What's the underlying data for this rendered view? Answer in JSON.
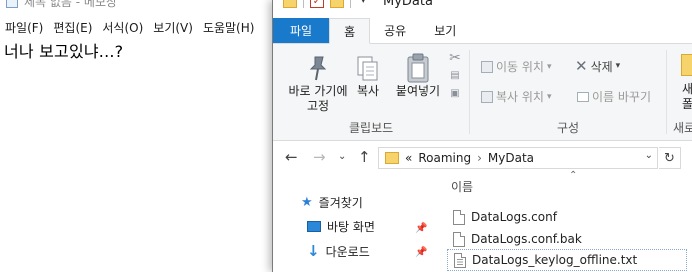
{
  "notepad": {
    "title": "제목 없음 - 메모장",
    "menu": [
      "파일(F)",
      "편집(E)",
      "서식(O)",
      "보기(V)",
      "도움말(H)"
    ],
    "content": "너나 보고있냐...?"
  },
  "explorer": {
    "title": "MyData",
    "tabs": {
      "file": "파일",
      "home": "홈",
      "share": "공유",
      "view": "보기"
    },
    "ribbon": {
      "pin_label_1": "바로 가기에",
      "pin_label_2": "고정",
      "copy_label": "복사",
      "paste_label": "붙여넣기",
      "clipboard_group": "클립보드",
      "move_to": "이동 위치",
      "copy_to": "복사 위치",
      "delete": "삭제",
      "rename": "이름 바꾸기",
      "organize_group": "구성",
      "new_partial_1": "새",
      "new_partial_2": "폴",
      "new_partial_3": "새로"
    },
    "address": {
      "prefix": "«",
      "path": [
        "Roaming",
        "MyData"
      ],
      "separator": "›"
    },
    "nav": {
      "quick_access": "즐겨찾기",
      "desktop": "바탕 화면",
      "downloads": "다운로드"
    },
    "files": {
      "column_name": "이름",
      "items": [
        "DataLogs.conf",
        "DataLogs.conf.bak",
        "DataLogs_keylog_offline.txt"
      ]
    }
  }
}
